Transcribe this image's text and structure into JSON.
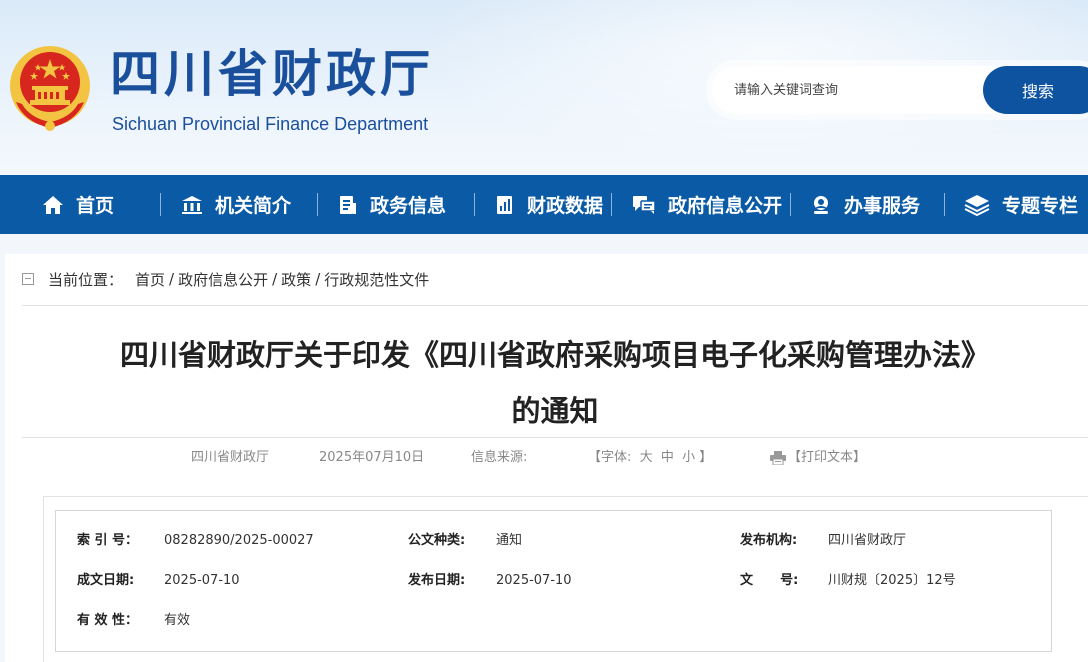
{
  "header": {
    "site_title": "四川省财政厅",
    "site_subtitle": "Sichuan Provincial Finance Department",
    "search_placeholder": "请输入关键词查询",
    "search_button": "搜索"
  },
  "nav": {
    "items": [
      {
        "label": "首页",
        "icon": "home-icon"
      },
      {
        "label": "机关简介",
        "icon": "bank-icon"
      },
      {
        "label": "政务信息",
        "icon": "document-icon"
      },
      {
        "label": "财政数据",
        "icon": "data-icon"
      },
      {
        "label": "政府信息公开",
        "icon": "chat-icon"
      },
      {
        "label": "办事服务",
        "icon": "user-icon"
      },
      {
        "label": "专题专栏",
        "icon": "layers-icon"
      }
    ]
  },
  "breadcrumb": {
    "prefix": "当前位置：",
    "items": [
      "首页",
      "政府信息公开",
      "政策",
      "行政规范性文件"
    ],
    "separator": "/"
  },
  "article": {
    "title_line1": "四川省财政厅关于印发《四川省政府采购项目电子化采购管理办法》",
    "title_line2": "的通知",
    "meta": {
      "publisher": "四川省财政厅",
      "date": "2025年07月10日",
      "source_label": "信息来源:",
      "font_size_label": "【字体:  大  中  小 】",
      "print_label": "【打印文本】"
    }
  },
  "info_table": {
    "index_no_label": "索 引 号：",
    "index_no": "08282890/2025-00027",
    "doc_type_label": "公文种类:",
    "doc_type": "通知",
    "issuer_label": "发布机构:",
    "issuer": "四川省财政厅",
    "created_label": "成文日期:",
    "created": "2025-07-10",
    "published_label": "发布日期:",
    "published": "2025-07-10",
    "doc_no_label": "文      号:",
    "doc_no": "川财规〔2025〕12号",
    "validity_label": "有 效 性：",
    "validity": "有效"
  },
  "colors": {
    "brand_blue": "#0b5aa6",
    "title_blue": "#1a4f9c",
    "emblem_red": "#d7261e",
    "emblem_gold": "#f3c442"
  }
}
